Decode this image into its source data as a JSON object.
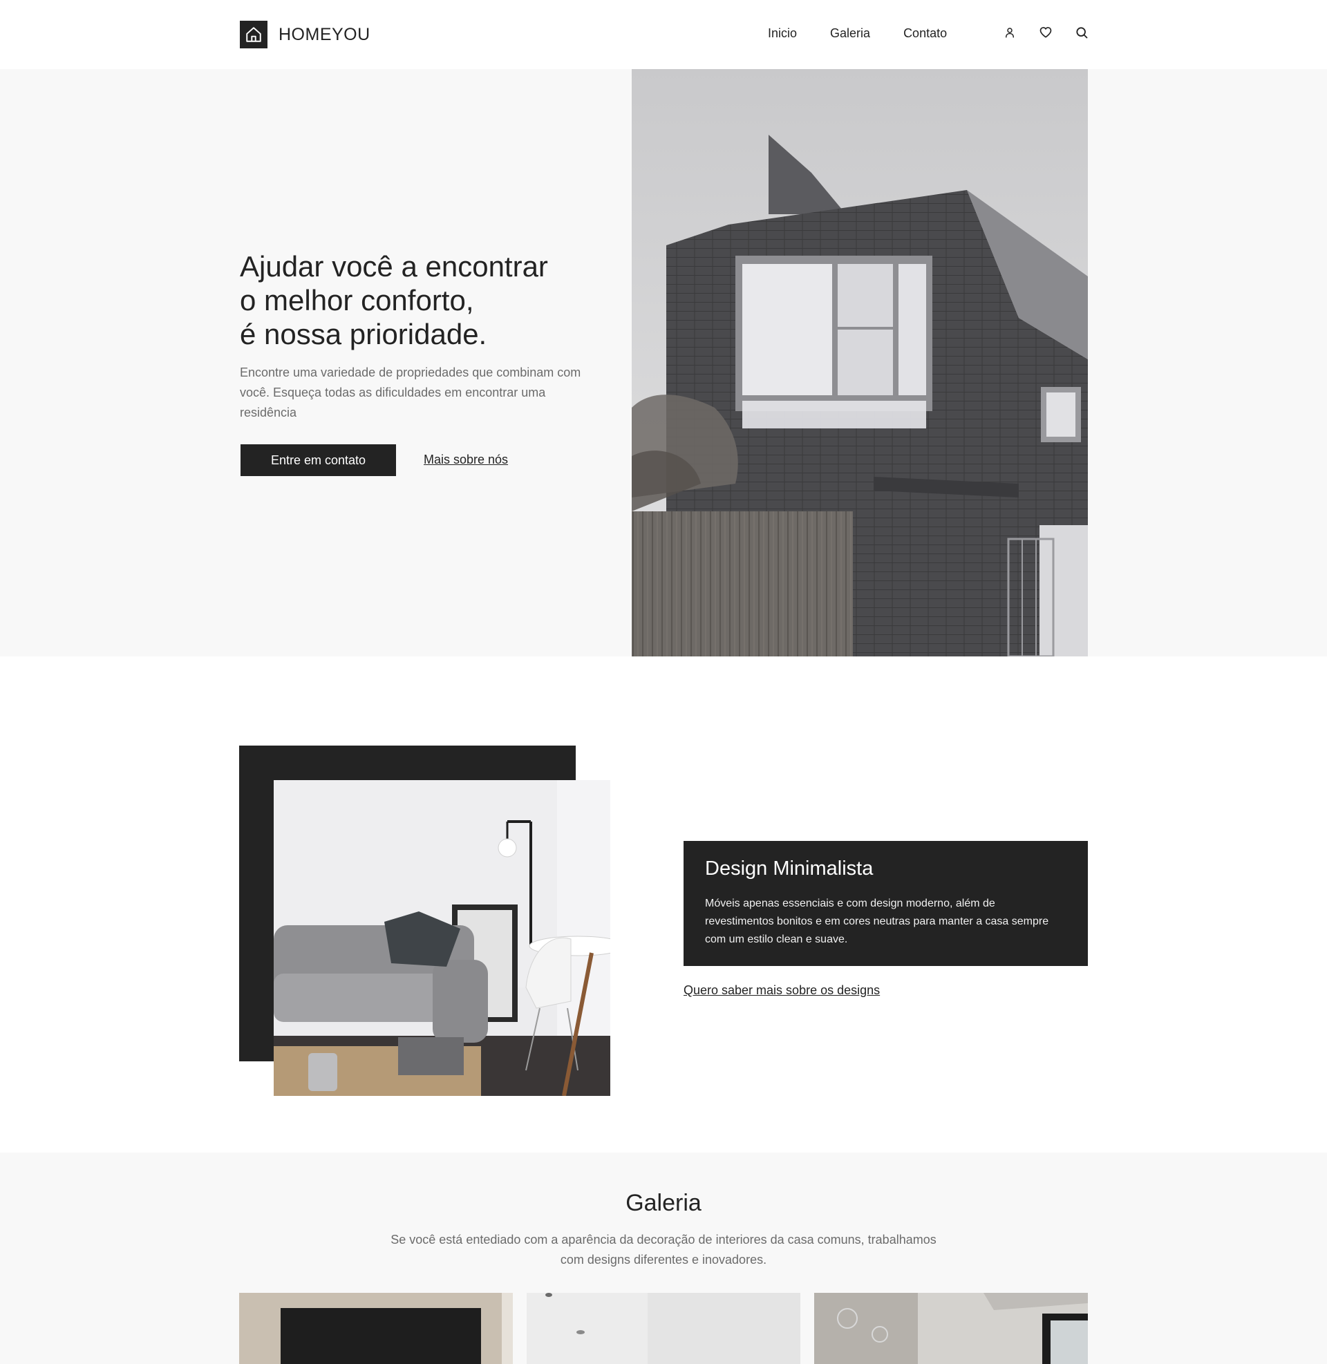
{
  "header": {
    "brand": "HOMEYOU",
    "nav": [
      "Inicio",
      "Galeria",
      "Contato"
    ],
    "icons": [
      "user-icon",
      "heart-icon",
      "search-icon"
    ]
  },
  "hero": {
    "title_lines": [
      "Ajudar você a encontrar",
      "o melhor conforto,",
      "é nossa prioridade."
    ],
    "description": "Encontre uma variedade de propriedades que combinam com você. Esqueça todas as dificuldades em encontrar uma residência",
    "primary_button": "Entre em contato",
    "secondary_link": "Mais sobre nós"
  },
  "design": {
    "title": "Design Minimalista",
    "description": "Móveis apenas essenciais e com design moderno, além de revestimentos bonitos e em cores neutras para manter a casa sempre com um estilo clean e suave.",
    "link": "Quero saber mais sobre os designs"
  },
  "gallery": {
    "title": "Galeria",
    "description": "Se você está entediado com a aparência da decoração de interiores da casa comuns, trabalhamos com designs diferentes e inovadores."
  },
  "colors": {
    "dark": "#232323",
    "hero_bg": "#f8f8f8",
    "muted_text": "#6b6b6b"
  }
}
